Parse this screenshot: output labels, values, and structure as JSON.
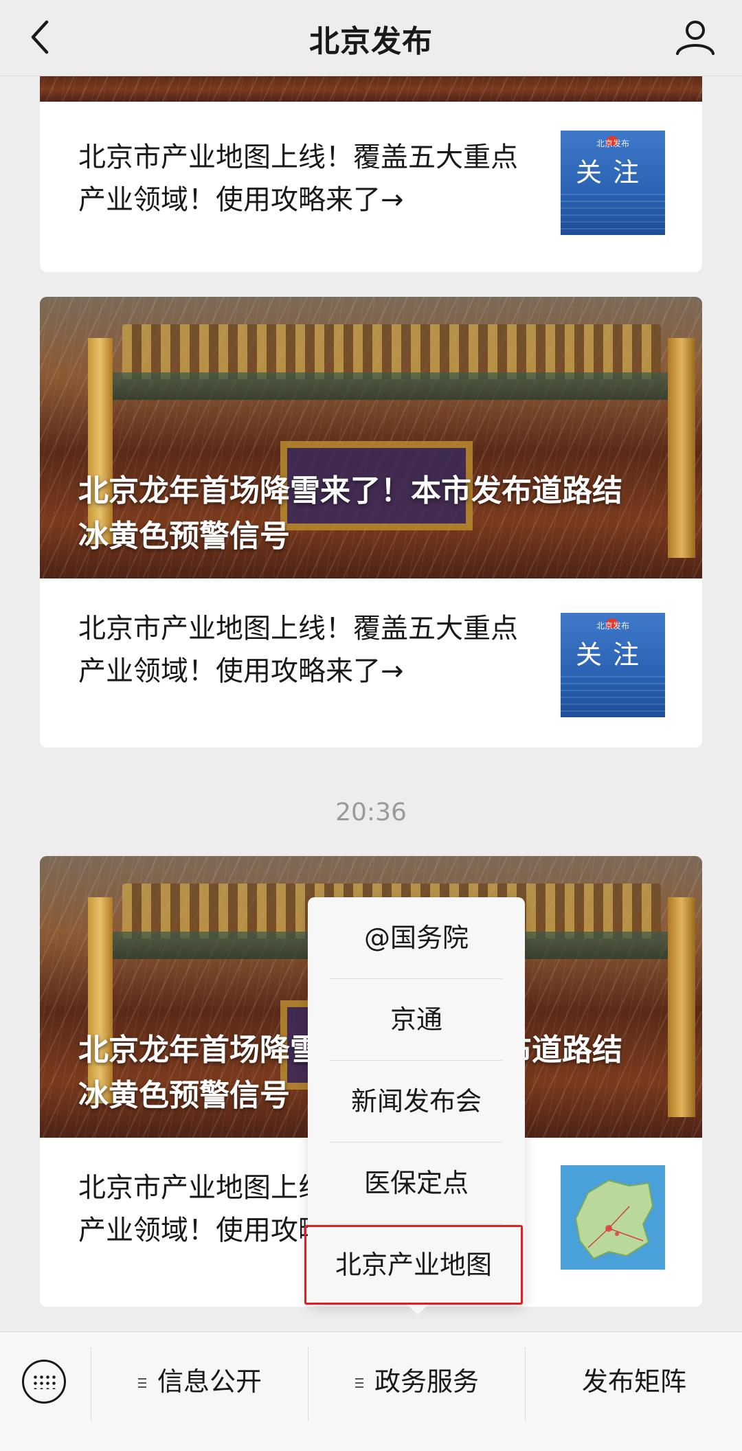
{
  "header": {
    "title": "北京发布"
  },
  "cards": [
    {
      "article_title": "北京市产业地图上线！覆盖五大重点产业领域！使用攻略来了→",
      "thumb_top": "北京发布",
      "thumb_main": "关注"
    },
    {
      "headline": "北京龙年首场降雪来了！本市发布道路结冰黄色预警信号",
      "article_title": "北京市产业地图上线！覆盖五大重点产业领域！使用攻略来了→",
      "thumb_top": "北京发布",
      "thumb_main": "关注"
    },
    {
      "headline": "北京龙年首场降雪来了！本市发布道路结冰黄色预警信号",
      "article_title": "北京市产业地图上线！覆盖五大重点产业领域！使用攻略来了→"
    }
  ],
  "timestamp": "20:36",
  "popup_menu": {
    "items": [
      "@国务院",
      "京通",
      "新闻发布会",
      "医保定点",
      "北京产业地图"
    ]
  },
  "bottom_menu": {
    "items": [
      "信息公开",
      "政务服务",
      "发布矩阵"
    ]
  },
  "colors": {
    "highlight": "#e02020",
    "thumb_blue": "#2a62b4",
    "background": "#ededed"
  }
}
